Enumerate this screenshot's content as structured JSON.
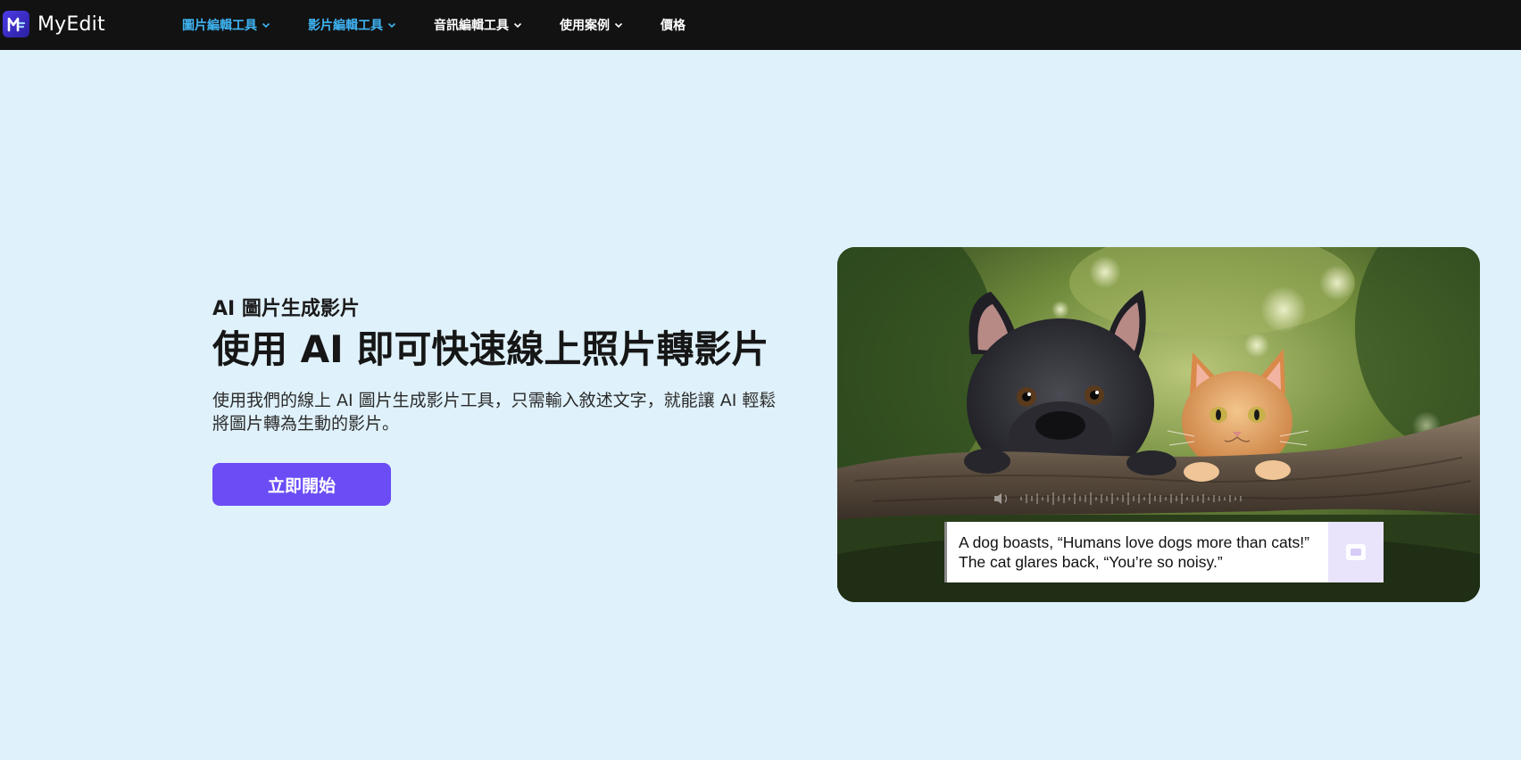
{
  "brand": {
    "name": "MyEdit",
    "accent": "#6b4cf5",
    "nav_active_color": "#3fb4f3"
  },
  "nav": {
    "items": [
      {
        "label": "圖片編輯工具",
        "has_dropdown": true,
        "active": true
      },
      {
        "label": "影片編輯工具",
        "has_dropdown": true,
        "active": true
      },
      {
        "label": "音訊編輯工具",
        "has_dropdown": true,
        "active": false
      },
      {
        "label": "使用案例",
        "has_dropdown": true,
        "active": false
      },
      {
        "label": "價格",
        "has_dropdown": false,
        "active": false
      }
    ]
  },
  "hero": {
    "eyebrow": "AI 圖片生成影片",
    "headline": "使用 AI 即可快速線上照片轉影片",
    "description": "使用我們的線上 AI 圖片生成影片工具，只需輸入敘述文字，就能讓 AI 輕鬆將圖片轉為生動的影片。",
    "cta_label": "立即開始"
  },
  "media": {
    "image_subject": "french-bulldog-and-orange-cat-on-branch",
    "caption_line1": "A dog boasts, “Humans love dogs more than cats!”",
    "caption_line2": "The cat glares back, “You’re so noisy.”",
    "icons": [
      "speaker-icon",
      "waveform-icon",
      "badge-icon"
    ]
  }
}
